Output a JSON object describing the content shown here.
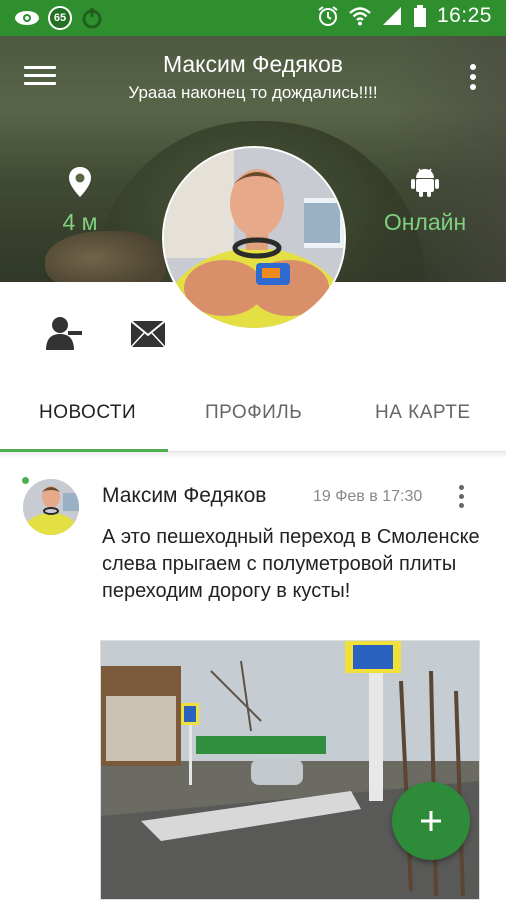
{
  "status_bar": {
    "time": "16:25",
    "badge": "65",
    "color": "#2f8f2f"
  },
  "profile": {
    "name": "Максим Федяков",
    "status": "Урааа наконец то дождались!!!!",
    "distance": "4 м",
    "online": "Онлайн",
    "accent": "#7fd07f"
  },
  "tabs": [
    {
      "label": "НОВОСТИ",
      "active": true
    },
    {
      "label": "ПРОФИЛЬ",
      "active": false
    },
    {
      "label": "НА КАРТЕ",
      "active": false
    }
  ],
  "post": {
    "author": "Максим Федяков",
    "date": "19 Фев в 17:30",
    "text": "А это пешеходный переход в Смоленске слева прыгаем с полуметровой плиты переходим дорогу в кусты!"
  },
  "icons": {
    "menu": "menu-icon",
    "more": "more-vert-icon",
    "location": "location-pin-icon",
    "android": "android-icon",
    "remove_friend": "remove-friend-icon",
    "mail": "mail-icon",
    "fab": "plus-icon"
  },
  "accent_color": "#4caf50"
}
